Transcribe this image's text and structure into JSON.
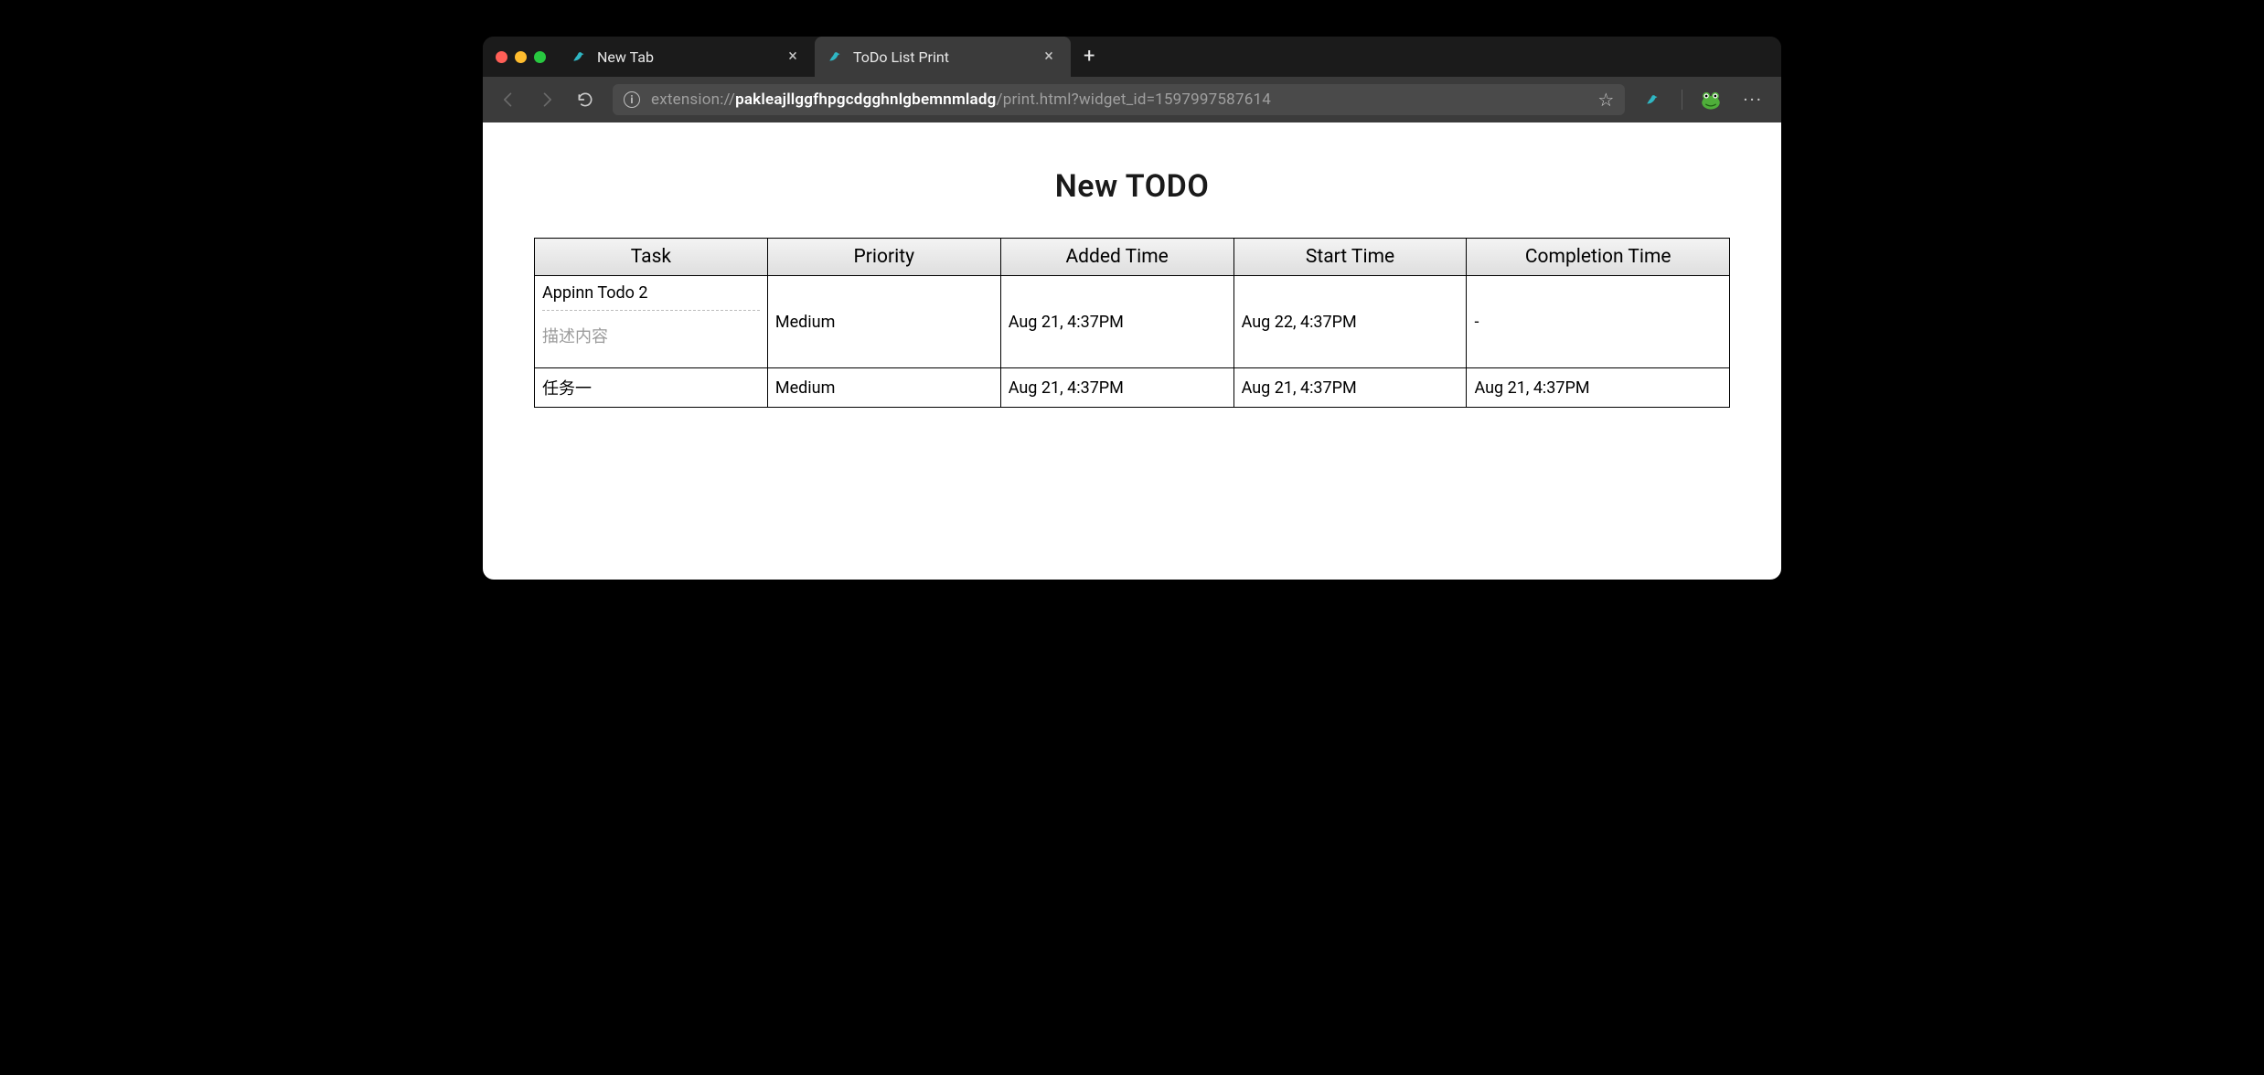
{
  "tabs": [
    {
      "title": "New Tab",
      "active": false
    },
    {
      "title": "ToDo List Print",
      "active": true
    }
  ],
  "address": {
    "scheme": "extension://",
    "host": "pakleajllggfhpgcdgghnlgbemnmladg",
    "path": "/print.html",
    "query": "?widget_id=1597997587614"
  },
  "page": {
    "title": "New TODO",
    "table": {
      "headers": [
        "Task",
        "Priority",
        "Added Time",
        "Start Time",
        "Completion Time"
      ],
      "rows": [
        {
          "task": "Appinn Todo 2",
          "desc": "描述内容",
          "priority": "Medium",
          "added_time": "Aug 21, 4:37PM",
          "start_time": "Aug 22, 4:37PM",
          "completion_time": "-"
        },
        {
          "task": "任务一",
          "desc": "",
          "priority": "Medium",
          "added_time": "Aug 21, 4:37PM",
          "start_time": "Aug 21, 4:37PM",
          "completion_time": "Aug 21, 4:37PM"
        }
      ]
    }
  }
}
